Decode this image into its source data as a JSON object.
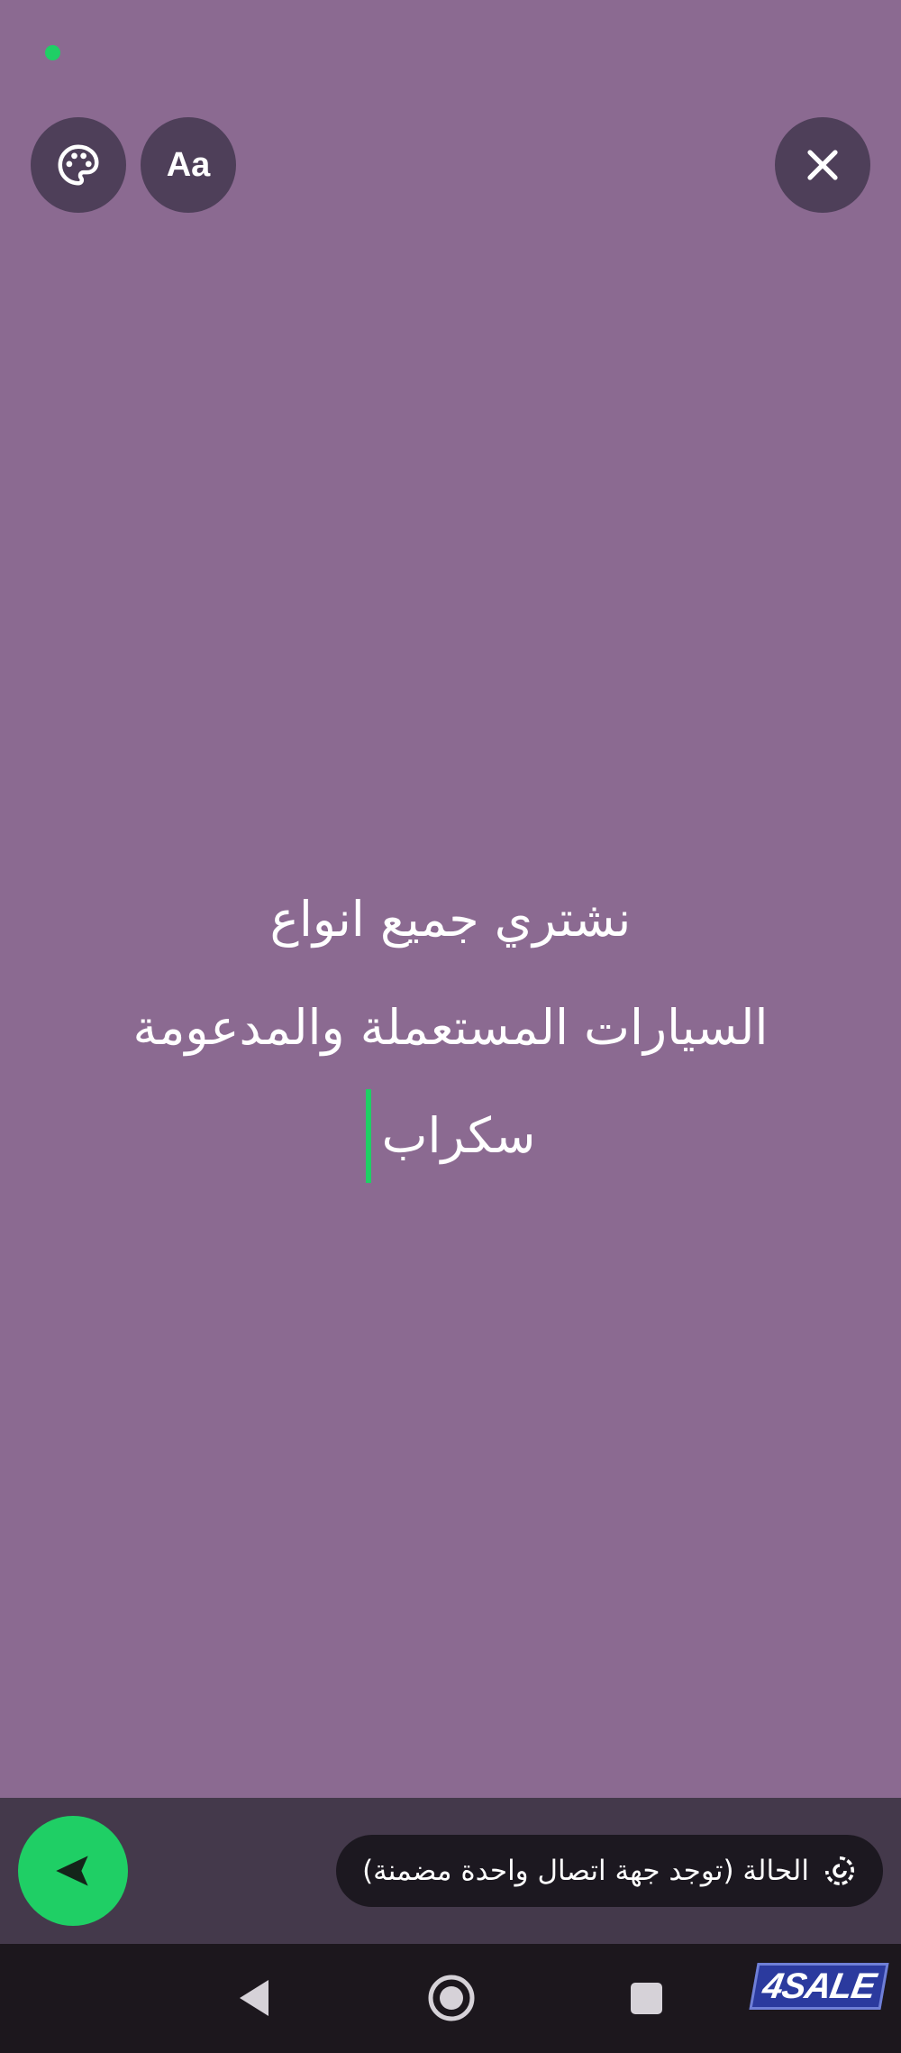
{
  "status_indicator": {
    "color": "#1fcf65"
  },
  "toolbar": {
    "palette_icon": "palette-icon",
    "font_label": "Aa",
    "close_icon": "close-icon"
  },
  "compose": {
    "lines": [
      "نشتري جميع انواع",
      "السيارات المستعملة والمدعومة",
      "سكراب"
    ],
    "background_color": "#8b6a91",
    "caret_color": "#1fcf65"
  },
  "footer": {
    "send_icon": "send-icon",
    "status_label": "الحالة (توجد جهة اتصال واحدة مضمنة)",
    "status_icon": "status-icon"
  },
  "nav": {
    "back_icon": "back-icon",
    "home_icon": "home-icon",
    "recents_icon": "recents-icon"
  },
  "watermark": {
    "text": "4SALE"
  }
}
